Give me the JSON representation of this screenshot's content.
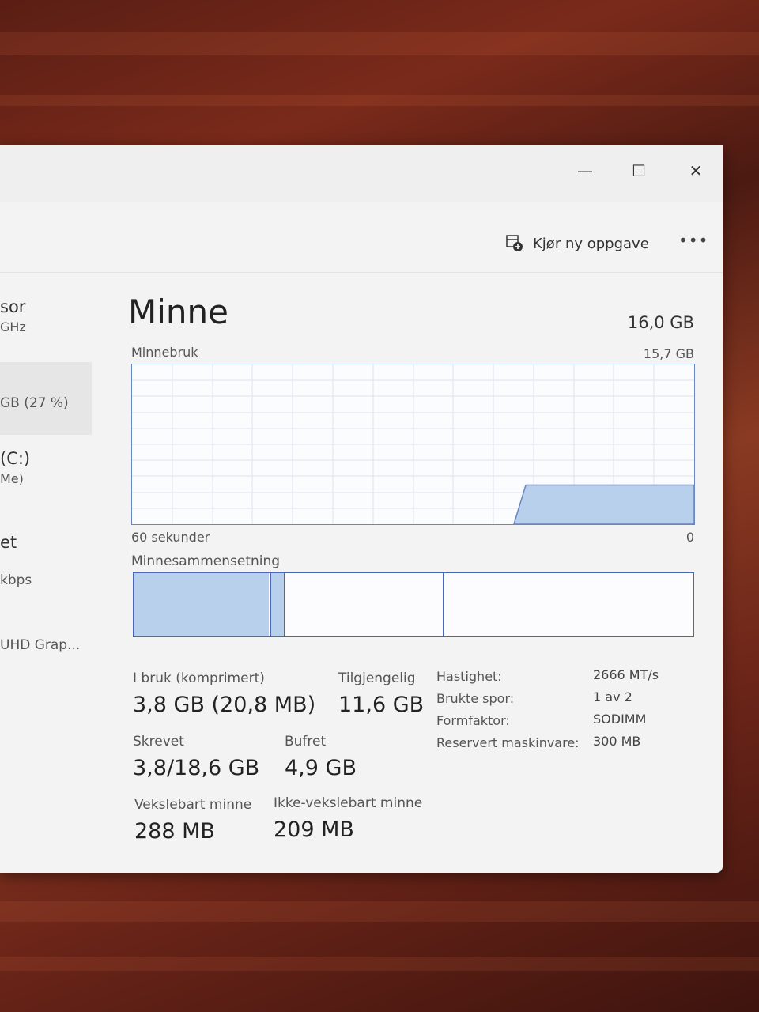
{
  "header": {
    "new_task_label": "Kjør ny oppgave",
    "more_label": "•••"
  },
  "window_controls": {
    "minimize": "—",
    "maximize": "☐",
    "close": "✕"
  },
  "sidebar": {
    "items": [
      {
        "line1": "sor",
        "line2": "GHz"
      },
      {
        "line1": "",
        "line2": "GB (27 %)"
      },
      {
        "line1": "(C:)",
        "line2": "Me)"
      },
      {
        "line1": "et",
        "line2": "kbps"
      },
      {
        "line1": "",
        "line2": "UHD Grap..."
      }
    ]
  },
  "main": {
    "title": "Minne",
    "total": "16,0 GB",
    "usage_label": "Minnebruk",
    "usage_max": "15,7 GB",
    "time_left": "60 sekunder",
    "time_right": "0",
    "composition_label": "Minnesammensetning"
  },
  "stats": {
    "in_use_label": "I bruk (komprimert)",
    "in_use_value": "3,8 GB (20,8 MB)",
    "available_label": "Tilgjengelig",
    "available_value": "11,6 GB",
    "committed_label": "Skrevet",
    "committed_value": "3,8/18,6 GB",
    "cached_label": "Bufret",
    "cached_value": "4,9 GB",
    "paged_label": "Vekslebart minne",
    "paged_value": "288 MB",
    "nonpaged_label": "Ikke-vekslebart minne",
    "nonpaged_value": "209 MB"
  },
  "properties": [
    {
      "label": "Hastighet:",
      "value": "2666 MT/s"
    },
    {
      "label": "Brukte spor:",
      "value": "1 av 2"
    },
    {
      "label": "Formfaktor:",
      "value": "SODIMM"
    },
    {
      "label": "Reservert maskinvare:",
      "value": "300 MB"
    }
  ],
  "graph_data": {
    "usage_fraction_recent": 0.245,
    "composition_fractions": {
      "in_use": 0.245,
      "modified": 0.025,
      "standby": 0.285,
      "free": 0.445
    }
  },
  "colors": {
    "accent": "#6a86c0",
    "fill": "#b9d0ec",
    "grid": "#dde4ef"
  }
}
